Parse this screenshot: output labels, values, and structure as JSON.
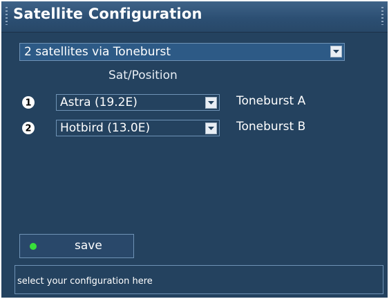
{
  "window": {
    "title": "Satellite Configuration"
  },
  "config_select": {
    "value": "2 satellites via Toneburst"
  },
  "columns": {
    "sat_position": "Sat/Position"
  },
  "satellites": [
    {
      "number": "1",
      "value": "Astra (19.2E)",
      "toneburst": "Toneburst A"
    },
    {
      "number": "2",
      "value": "Hotbird (13.0E)",
      "toneburst": "Toneburst B"
    }
  ],
  "save_button": {
    "label": "save",
    "indicator_color": "#38e03a"
  },
  "status": {
    "text": "select your configuration here"
  },
  "colors": {
    "background": "#24425f",
    "title_bar": "#2c4f73",
    "border": "#6f93b6"
  }
}
